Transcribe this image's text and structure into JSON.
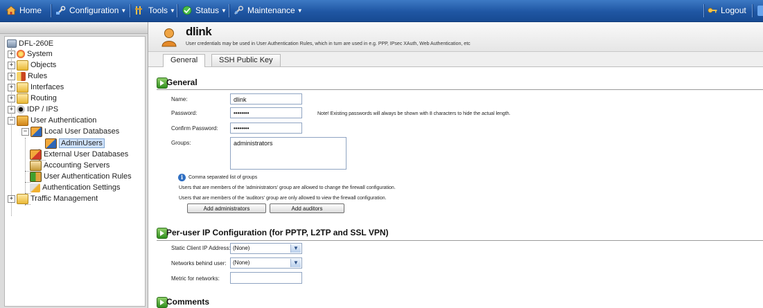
{
  "menubar": {
    "home": "Home",
    "configuration": "Configuration",
    "tools": "Tools",
    "status": "Status",
    "maintenance": "Maintenance",
    "logout": "Logout",
    "icons": [
      "house-icon",
      "wrench-icon",
      "tools-icon",
      "status-icon",
      "maintenance-icon",
      "key-icon"
    ]
  },
  "tree": {
    "root": "DFL-260E",
    "items": [
      {
        "label": "System"
      },
      {
        "label": "Objects"
      },
      {
        "label": "Rules"
      },
      {
        "label": "Interfaces"
      },
      {
        "label": "Routing"
      },
      {
        "label": "IDP / IPS"
      },
      {
        "label": "User Authentication"
      },
      {
        "label": "Local User Databases"
      },
      {
        "label": "AdminUsers"
      },
      {
        "label": "External User Databases"
      },
      {
        "label": "Accounting Servers"
      },
      {
        "label": "User Authentication Rules"
      },
      {
        "label": "Authentication Settings"
      },
      {
        "label": "Traffic Management"
      }
    ]
  },
  "page": {
    "title": "dlink",
    "description": "User credentials may be used in User Authentication Rules, which in turn are used in e.g. PPP, IPsec XAuth, Web Authentication, etc"
  },
  "tabs": [
    "General",
    "SSH Public Key"
  ],
  "general": {
    "heading": "General",
    "name_label": "Name:",
    "name_value": "dlink",
    "password_label": "Password:",
    "password_value": "••••••••",
    "password_note": "Note! Existing passwords will always be shown with 8 characters to hide the actual length.",
    "confirm_label": "Confirm Password:",
    "confirm_value": "••••••••",
    "groups_label": "Groups:",
    "groups_value": "administrators",
    "hint": "Comma separated list of groups",
    "admin_note": "Users that are members of the 'administrators' group are allowed to change the firewall configuration.",
    "auditor_note": "Users that are members of the 'auditors' group are only allowed to view the firewall configuration.",
    "add_admins": "Add administrators",
    "add_auditors": "Add auditors"
  },
  "peruser": {
    "heading": "Per-user IP Configuration (for PPTP, L2TP and SSL VPN)",
    "static_ip_label": "Static Client IP Address:",
    "static_ip_value": "(None)",
    "networks_label": "Networks behind user:",
    "networks_value": "(None)",
    "metric_label": "Metric for networks:",
    "metric_value": ""
  },
  "comments": {
    "heading": "Comments"
  },
  "colors": {
    "menubar": "#1f56a3",
    "accent_green": "#2f8e1e",
    "info_blue": "#2f6fc2"
  }
}
